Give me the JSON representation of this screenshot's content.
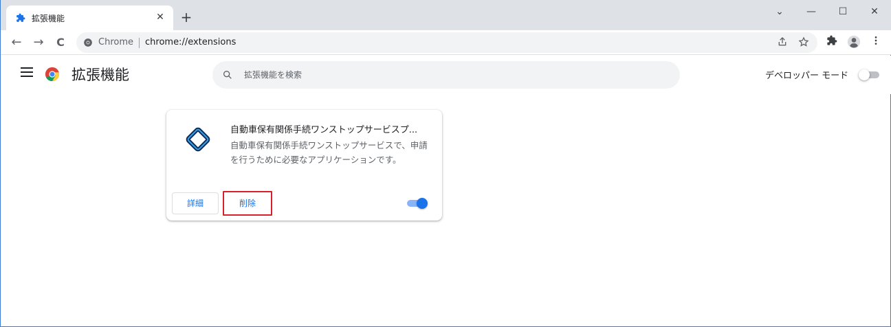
{
  "window": {
    "tab_title": "拡張機能",
    "close_tab_glyph": "✕",
    "new_tab_glyph": "+",
    "controls": {
      "dropdown": "⌄",
      "minimize": "—",
      "maximize": "☐",
      "close": "✕"
    }
  },
  "toolbar": {
    "back_glyph": "←",
    "forward_glyph": "→",
    "reload_glyph": "C",
    "omnibox_label": "Chrome",
    "omnibox_url": "chrome://extensions",
    "share_icon": "share-icon",
    "bookmark_icon": "star-icon",
    "extensions_icon": "puzzle-icon",
    "profile_icon": "profile-icon",
    "menu_icon": "more-vert-icon"
  },
  "header": {
    "title": "拡張機能",
    "search_placeholder": "拡張機能を検索",
    "developer_mode_label": "デベロッパー モード",
    "developer_mode_on": false
  },
  "extension": {
    "name": "自動車保有関係手続ワンストップサービスプ...",
    "description": "自動車保有関係手続ワンストップサービスで、申請を行うために必要なアプリケーションです。",
    "details_label": "詳細",
    "remove_label": "削除",
    "enabled": true
  },
  "colors": {
    "accent": "#1a73e8",
    "highlight_border": "#d9202a",
    "tabstrip": "#dee1e6"
  }
}
